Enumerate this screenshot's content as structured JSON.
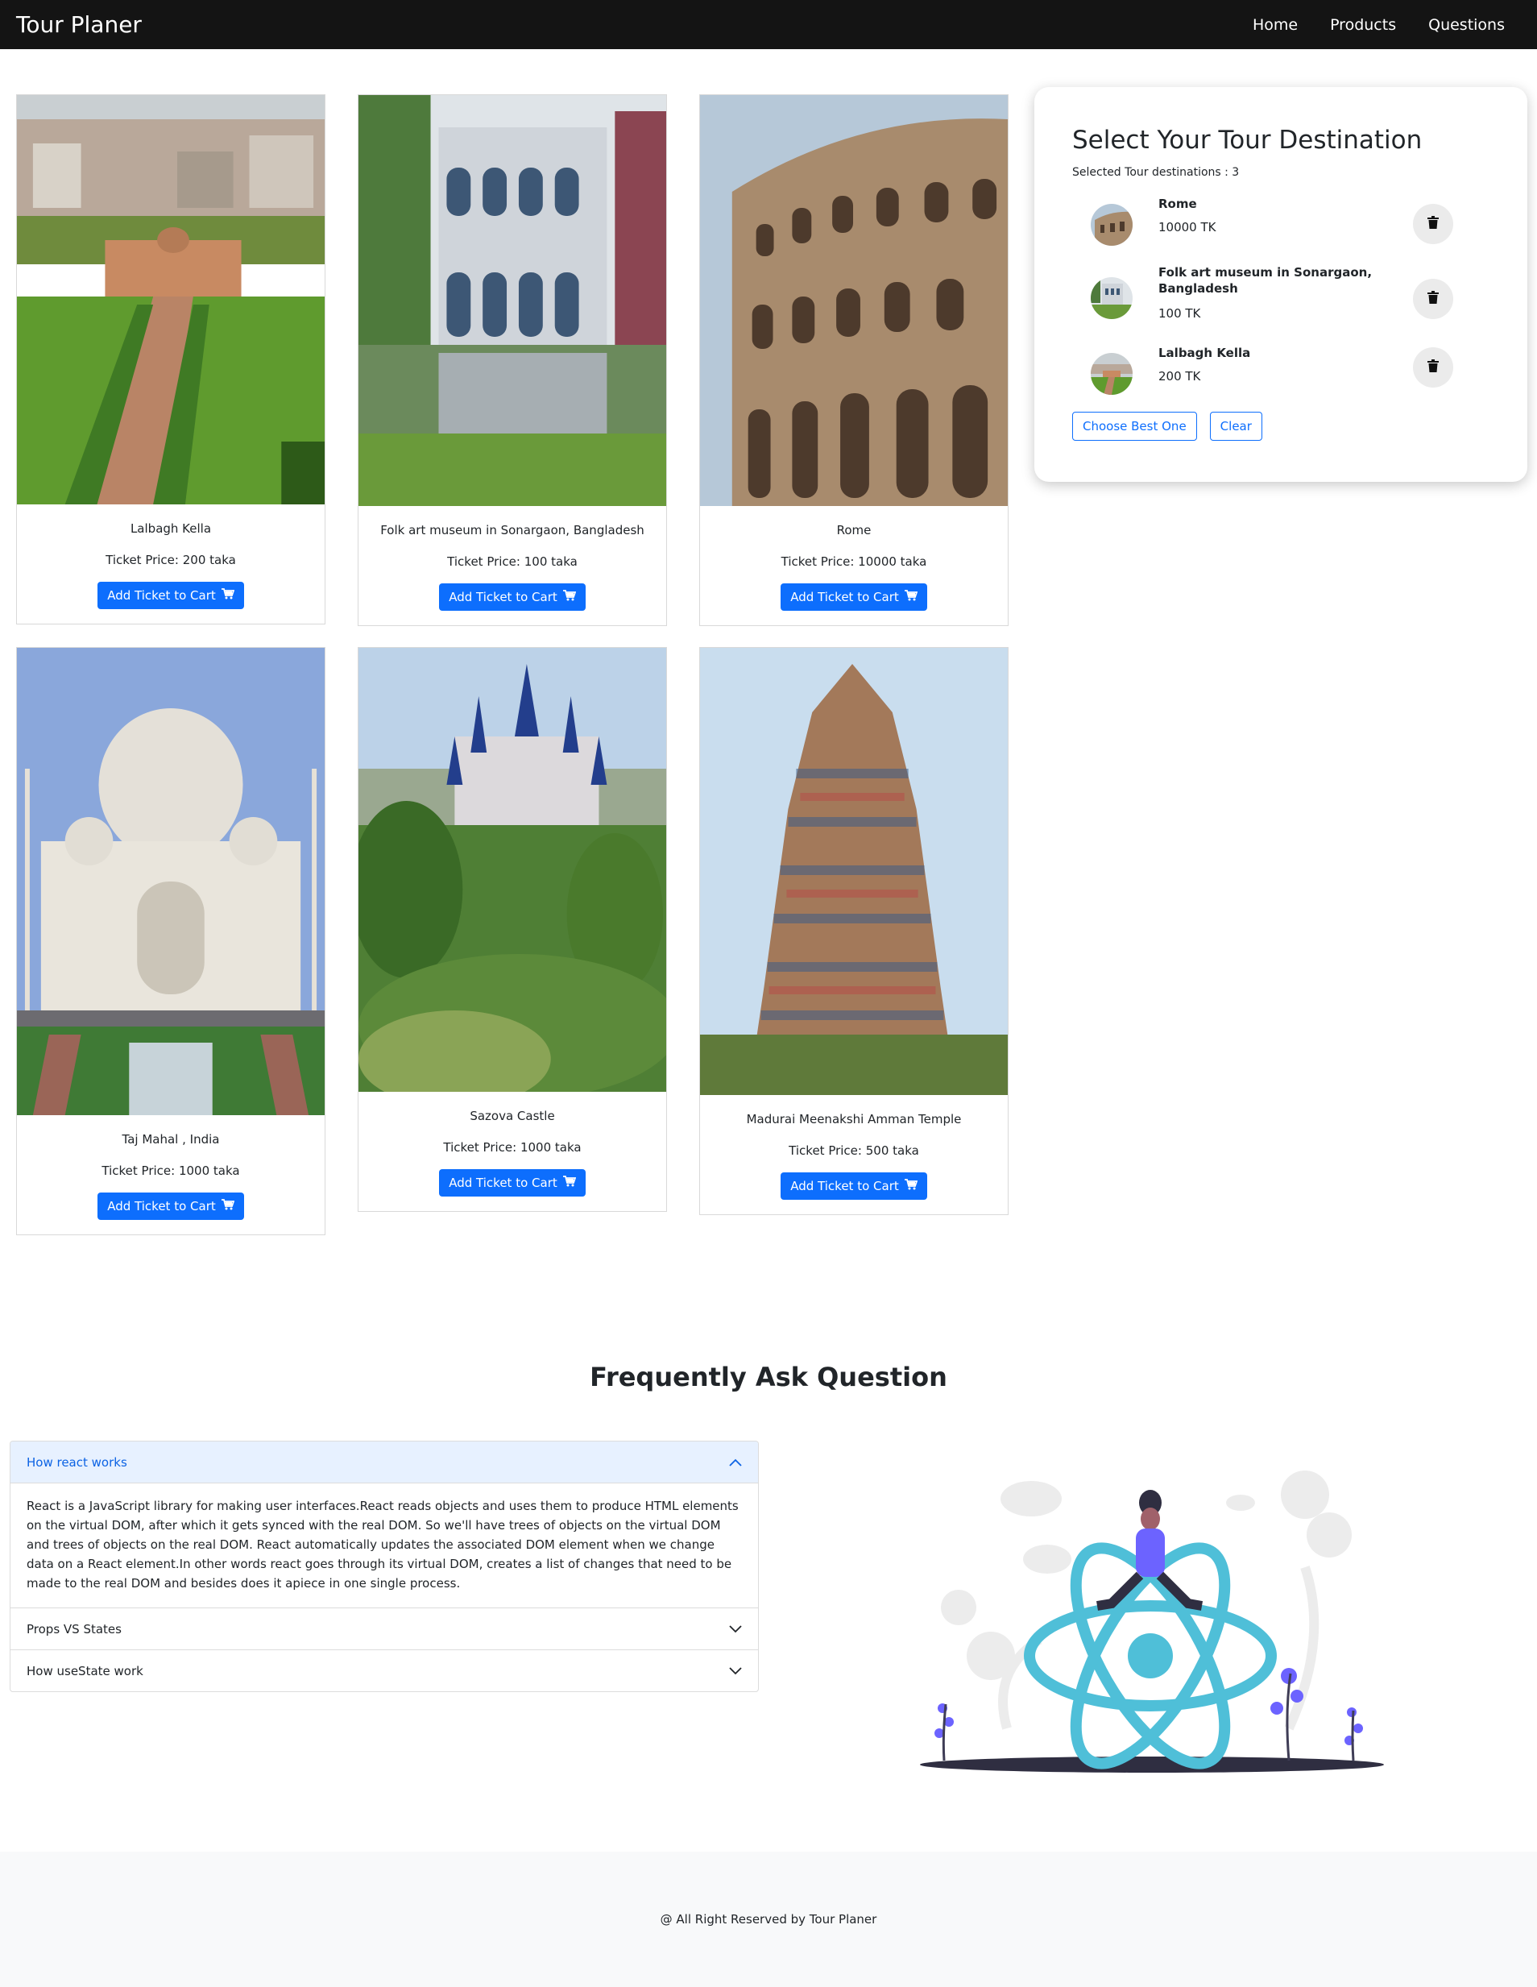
{
  "navbar": {
    "brand": "Tour Planer",
    "links": [
      "Home",
      "Products",
      "Questions"
    ]
  },
  "products": [
    {
      "name": "Lalbagh Kella",
      "price": "Ticket Price: 200 taka",
      "button": "Add Ticket to Cart"
    },
    {
      "name": "Folk art museum in Sonargaon, Bangladesh",
      "price": "Ticket Price: 100 taka",
      "button": "Add Ticket to Cart"
    },
    {
      "name": "Rome",
      "price": "Ticket Price: 10000 taka",
      "button": "Add Ticket to Cart"
    },
    {
      "name": "Taj Mahal , India",
      "price": "Ticket Price: 1000 taka",
      "button": "Add Ticket to Cart"
    },
    {
      "name": "Sazova Castle",
      "price": "Ticket Price: 1000 taka",
      "button": "Add Ticket to Cart"
    },
    {
      "name": "Madurai Meenakshi Amman Temple",
      "price": "Ticket Price: 500 taka",
      "button": "Add Ticket to Cart"
    }
  ],
  "cart": {
    "title": "Select Your Tour Destination",
    "count": "Selected Tour destinations : 3",
    "items": [
      {
        "name": "Rome",
        "price": "10000 TK"
      },
      {
        "name": "Folk art museum in Sonargaon, Bangladesh",
        "price": "100 TK"
      },
      {
        "name": "Lalbagh Kella",
        "price": "200 TK"
      }
    ],
    "choose_label": "Choose Best One",
    "clear_label": "Clear"
  },
  "faq": {
    "title": "Frequently Ask Question",
    "items": [
      {
        "question": "How react works",
        "answer": "React is a JavaScript library for making user interfaces.React reads objects and uses them to produce HTML elements on the virtual DOM, after which it gets synced with the real DOM. So we'll have trees of objects on the virtual DOM and trees of objects on the real DOM. React automatically updates the associated DOM element when we change data on a React element.In other words react goes through its virtual DOM, creates a list of changes that need to be made to the real DOM and besides does it apiece in one single process."
      },
      {
        "question": "Props VS States"
      },
      {
        "question": "How useState work"
      }
    ]
  },
  "footer": {
    "text": "@ All Right Reserved by Tour Planer"
  },
  "icons": {
    "cart": "cart-icon",
    "delete": "trash-icon",
    "chevron": "chevron-icon"
  },
  "colors": {
    "primary": "#0d6efd",
    "navbar": "#141414",
    "accent_react": "#4fbfd8",
    "person": "#6c63ff"
  }
}
